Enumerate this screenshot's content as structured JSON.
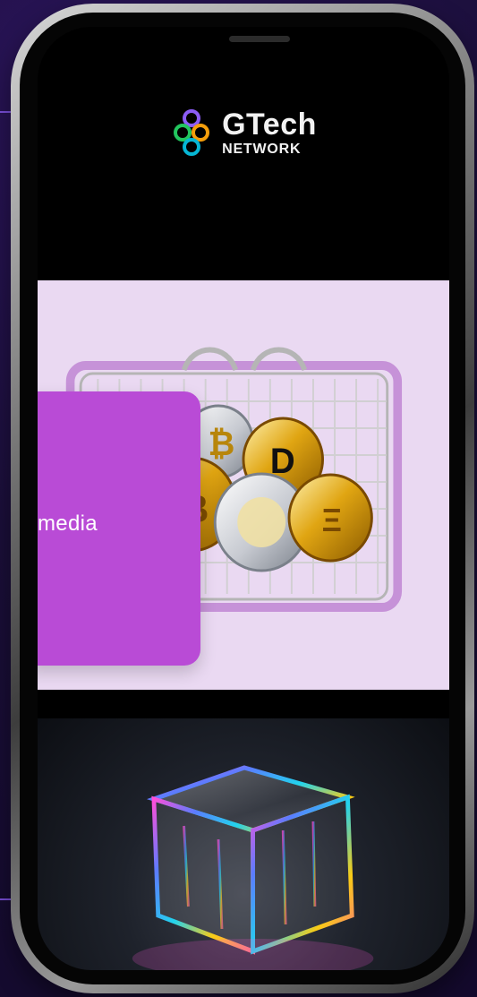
{
  "brand": {
    "name": "GTech",
    "subtitle": "NETWORK"
  },
  "overlay_card": {
    "text": "media"
  },
  "colors": {
    "background": "#1b0f3a",
    "accent": "#8b5cf6",
    "card_purple": "#b94bd6",
    "hero_pink": "#ead9f2"
  },
  "icons": {
    "brand_logo": "network-loop-icon"
  }
}
